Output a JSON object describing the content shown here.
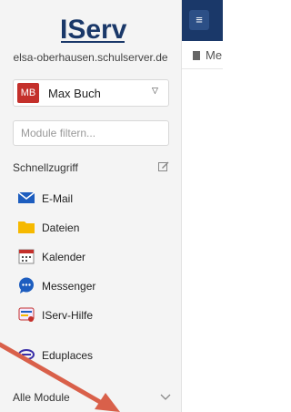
{
  "sidebar": {
    "logo_text": "IServ",
    "domain": "elsa-oberhausen.schulserver.de",
    "user": {
      "initials": "MB",
      "name": "Max Buch"
    },
    "filter_placeholder": "Module filtern...",
    "quick_title": "Schnellzugriff",
    "items": [
      {
        "label": "E-Mail",
        "icon": "mail-icon"
      },
      {
        "label": "Dateien",
        "icon": "folder-icon"
      },
      {
        "label": "Kalender",
        "icon": "calendar-icon"
      },
      {
        "label": "Messenger",
        "icon": "chat-icon"
      },
      {
        "label": "IServ-Hilfe",
        "icon": "help-icon"
      },
      {
        "label": "Eduplaces",
        "icon": "eduplaces-icon"
      }
    ],
    "all_modules": "Alle Module"
  },
  "main": {
    "menu_glyph": "≡",
    "breadcrumb": "Me"
  },
  "colors": {
    "brand": "#1a3869",
    "avatar": "#c4302b",
    "arrow": "#d9604a"
  }
}
